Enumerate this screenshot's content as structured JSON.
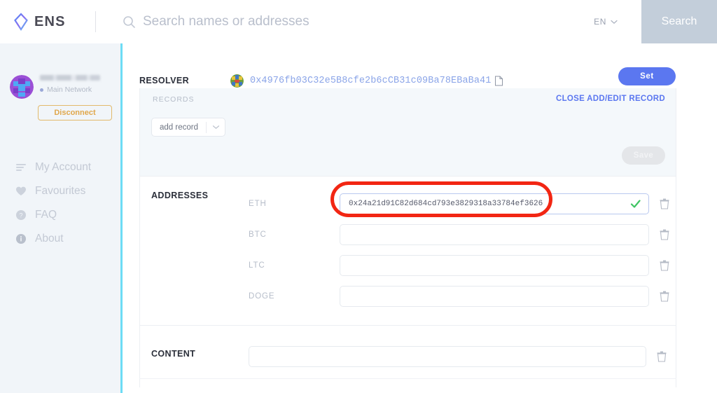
{
  "header": {
    "brand": "ENS",
    "logo_icon": "ens-diamond-logo",
    "search_icon": "search-icon",
    "search_placeholder": "Search names or addresses",
    "search_value": "",
    "language": "EN",
    "language_chevron_icon": "chevron-down-icon",
    "search_button": "Search",
    "search_button_color": "#c3ceda"
  },
  "sidebar": {
    "avatar_icon": "identicon-avatar",
    "address_masked": "",
    "network_label": "Main Network",
    "network_dot_color": "#9aa8d8",
    "disconnect_label": "Disconnect",
    "disconnect_color": "#e0a74b",
    "accent_color": "#6ddcf5",
    "items": [
      {
        "label": "My Account",
        "icon": "list-lines-icon"
      },
      {
        "label": "Favourites",
        "icon": "heart-icon"
      },
      {
        "label": "FAQ",
        "icon": "question-circle-icon"
      },
      {
        "label": "About",
        "icon": "info-circle-icon"
      }
    ]
  },
  "main": {
    "resolver": {
      "label": "RESOLVER",
      "identicon": "resolver-identicon",
      "address": "0x4976fb03C32e5B8cfe2b6cCB31c09Ba78EBaBa41",
      "address_color": "#8aa4e8",
      "copy_icon": "copy-icon",
      "set_button": "Set",
      "set_button_color": "#5b77f0"
    },
    "records": {
      "label": "RECORDS",
      "close_link": "CLOSE ADD/EDIT RECORD",
      "close_link_color": "#5b77f0",
      "add_record_value": "add record",
      "add_record_chevron_icon": "chevron-down-icon",
      "save_button": "Save",
      "save_button_disabled": true
    },
    "addresses": {
      "label": "ADDRESSES",
      "rows": [
        {
          "key": "ETH",
          "value": "0x24a21d91C82d684cd793e3829318a33784ef3626",
          "placeholder": "",
          "valid": true,
          "focused": true,
          "check_icon": "check-icon",
          "check_color": "#3fc463",
          "delete_icon": "trash-icon"
        },
        {
          "key": "BTC",
          "value": "",
          "placeholder": "",
          "valid": false,
          "focused": false,
          "check_icon": "",
          "check_color": "",
          "delete_icon": "trash-icon"
        },
        {
          "key": "LTC",
          "value": "",
          "placeholder": "",
          "valid": false,
          "focused": false,
          "check_icon": "",
          "check_color": "",
          "delete_icon": "trash-icon"
        },
        {
          "key": "DOGE",
          "value": "",
          "placeholder": "",
          "valid": false,
          "focused": false,
          "check_icon": "",
          "check_color": "",
          "delete_icon": "trash-icon"
        }
      ]
    },
    "content": {
      "label": "CONTENT",
      "value": "",
      "placeholder": "",
      "delete_icon": "trash-icon"
    }
  },
  "annotation": {
    "shape": "red-ellipse-highlight",
    "color": "#f22613",
    "targets": "eth-address-input"
  }
}
